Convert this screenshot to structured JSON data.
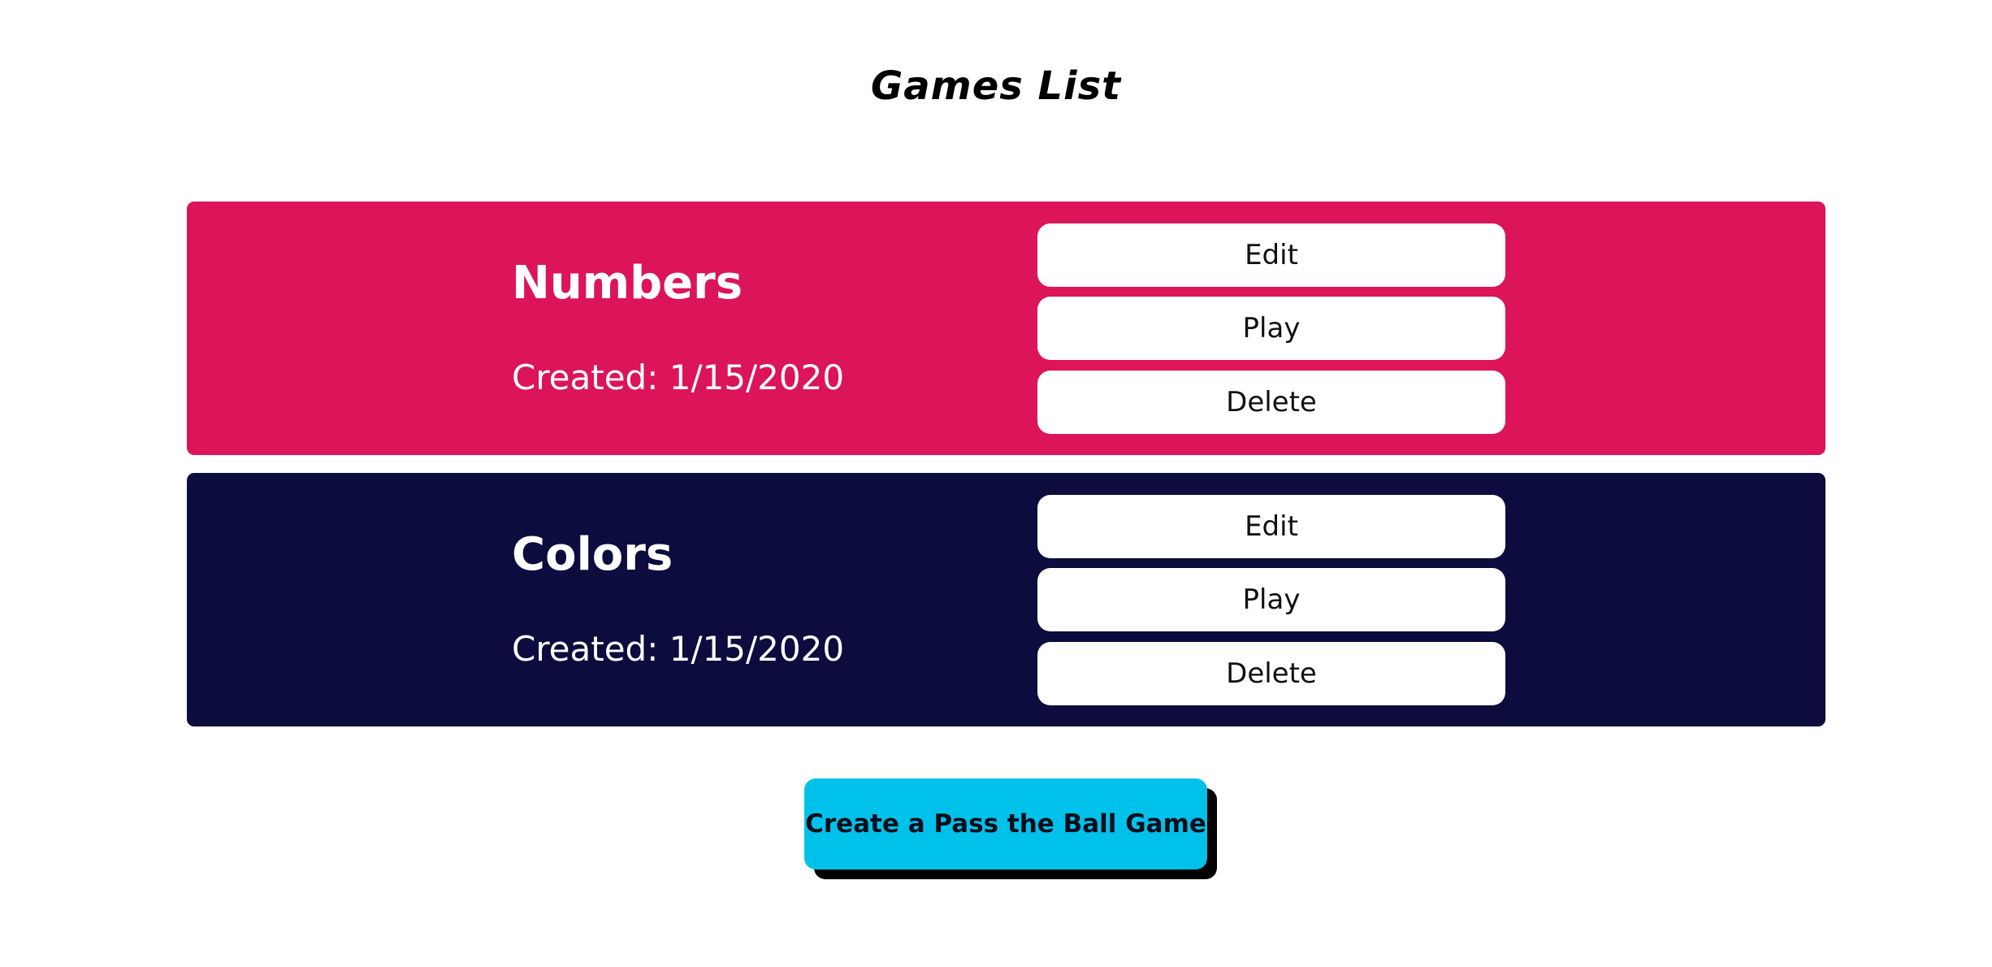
{
  "page": {
    "title": "Games List"
  },
  "games": [
    {
      "name": "Numbers",
      "created": "Created: 1/15/2020",
      "color": "#dc1459",
      "edit_label": "Edit",
      "play_label": "Play",
      "delete_label": "Delete"
    },
    {
      "name": "Colors",
      "created": "Created: 1/15/2020",
      "color": "#0c0c3e",
      "edit_label": "Edit",
      "play_label": "Play",
      "delete_label": "Delete"
    }
  ],
  "create_button": {
    "label": "Create a Pass the Ball Game",
    "color": "#00c1ea",
    "shadow_color": "#000000"
  }
}
